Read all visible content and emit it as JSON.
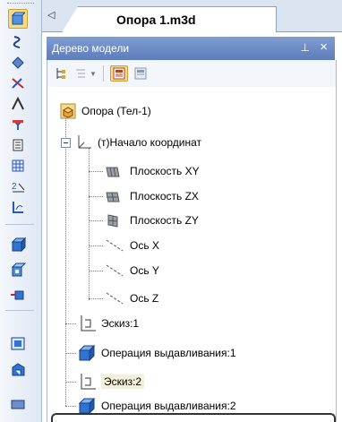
{
  "tabs": {
    "active_document": "Опора 1.m3d",
    "scroll_left_glyph": "◁"
  },
  "panel": {
    "title": "Дерево модели",
    "pin_glyph": "⊥",
    "close_glyph": "×"
  },
  "tree": {
    "root": "Опора (Тел-1)",
    "origin": "(т)Начало координат",
    "planes": [
      "Плоскость XY",
      "Плоскость ZX",
      "Плоскость ZY"
    ],
    "axes": [
      "Ось X",
      "Ось Y",
      "Ось Z"
    ],
    "operations": [
      "Эскиз:1",
      "Операция выдавливания:1",
      "Эскиз:2",
      "Операция выдавливания:2"
    ],
    "selected": "Эскиз:2"
  },
  "colors": {
    "panel_header": "#6684c2",
    "toolbar_bg": "#e3eaf5",
    "selection": "#f3efd9",
    "extrude_blue": "#2f74d0"
  }
}
